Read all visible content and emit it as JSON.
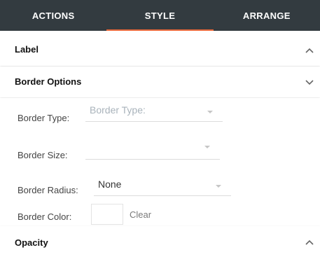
{
  "tabs": [
    {
      "label": "ACTIONS",
      "active": false
    },
    {
      "label": "STYLE",
      "active": true
    },
    {
      "label": "ARRANGE",
      "active": false
    }
  ],
  "sections": {
    "label": {
      "title": "Label",
      "chevron": "chevron-up-icon"
    },
    "border_options": {
      "title": "Border Options",
      "chevron": "chevron-down-icon"
    },
    "opacity": {
      "title": "Opacity",
      "chevron": "chevron-up-icon"
    }
  },
  "border_options": {
    "border_type": {
      "label": "Border Type:",
      "value": "",
      "placeholder": "Border Type:"
    },
    "border_size": {
      "label": "Border Size:",
      "value": ""
    },
    "border_radius": {
      "label": "Border Radius:",
      "value": "None"
    },
    "border_color": {
      "label": "Border Color:",
      "swatch": "#ffffff",
      "clear_label": "Clear"
    }
  },
  "colors": {
    "tab_bar": "#333b40",
    "tab_active_underline": "#ee6b3c"
  }
}
